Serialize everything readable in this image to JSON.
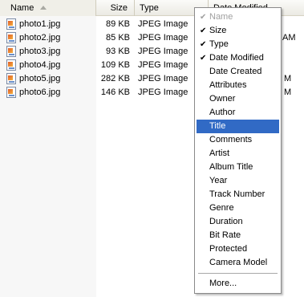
{
  "columns": {
    "name": "Name",
    "size": "Size",
    "type": "Type",
    "date_modified": "Date Modified"
  },
  "files": [
    {
      "name": "photo1.jpg",
      "size": "89 KB",
      "type": "JPEG Image",
      "date": ""
    },
    {
      "name": "photo2.jpg",
      "size": "85 KB",
      "type": "JPEG Image",
      "date": "AM"
    },
    {
      "name": "photo3.jpg",
      "size": "93 KB",
      "type": "JPEG Image",
      "date": ""
    },
    {
      "name": "photo4.jpg",
      "size": "109 KB",
      "type": "JPEG Image",
      "date": ""
    },
    {
      "name": "photo5.jpg",
      "size": "282 KB",
      "type": "JPEG Image",
      "date": "M"
    },
    {
      "name": "photo6.jpg",
      "size": "146 KB",
      "type": "JPEG Image",
      "date": "M"
    }
  ],
  "menu": {
    "check_glyph": "✔",
    "items": [
      {
        "label": "Name",
        "checked": true,
        "disabled": true
      },
      {
        "label": "Size",
        "checked": true
      },
      {
        "label": "Type",
        "checked": true
      },
      {
        "label": "Date Modified",
        "checked": true
      },
      {
        "label": "Date Created"
      },
      {
        "label": "Attributes"
      },
      {
        "label": "Owner"
      },
      {
        "label": "Author"
      },
      {
        "label": "Title",
        "highlighted": true
      },
      {
        "label": "Comments"
      },
      {
        "label": "Artist"
      },
      {
        "label": "Album Title"
      },
      {
        "label": "Year"
      },
      {
        "label": "Track Number"
      },
      {
        "label": "Genre"
      },
      {
        "label": "Duration"
      },
      {
        "label": "Bit Rate"
      },
      {
        "label": "Protected"
      },
      {
        "label": "Camera Model"
      }
    ],
    "more_label": "More..."
  },
  "colors": {
    "highlight": "#316ac5",
    "disabled_text": "#a0a0a0"
  }
}
